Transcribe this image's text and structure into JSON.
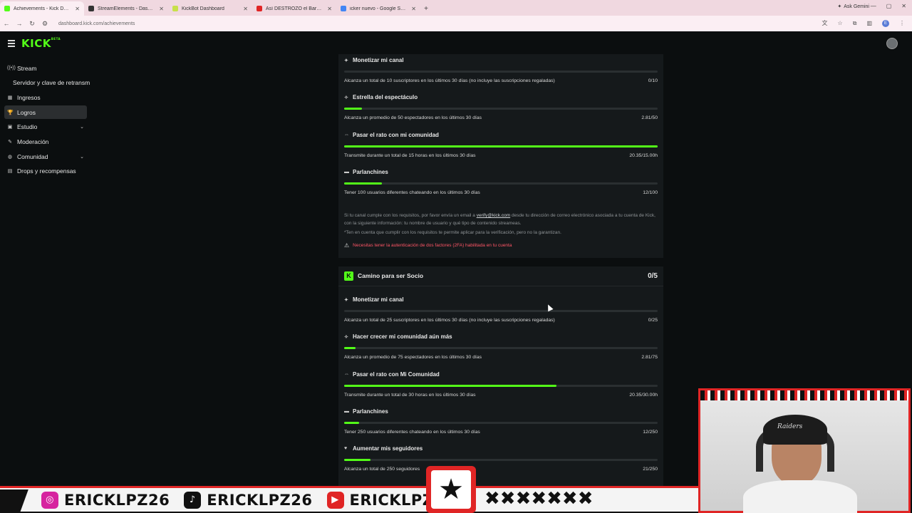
{
  "browser": {
    "tabs": [
      {
        "label": "Achievements - Kick Dashboard",
        "color": "#53fc18",
        "active": true
      },
      {
        "label": "StreamElements - Dashboard",
        "color": "#333333",
        "active": false
      },
      {
        "label": "KickBot Dashboard",
        "color": "#c8e04a",
        "active": false
      },
      {
        "label": "Así DESTROZÓ el Barça de Flick...",
        "color": "#e02525",
        "active": false
      },
      {
        "label": "icker nuevo - Google Search",
        "color": "#4285f4",
        "active": false
      }
    ],
    "new_tab": "+",
    "gemini": "Ask Gemini",
    "url": "dashboard.kick.com/achievements",
    "profile_letter": "E"
  },
  "app": {
    "logo": "KICK",
    "logo_sup": "BETA"
  },
  "sidebar": {
    "items": [
      {
        "label": "Stream",
        "icon": "stream-icon",
        "glyph": "((•))",
        "sub": false,
        "active": false,
        "chevron": false
      },
      {
        "label": "Servidor y clave de retransm",
        "icon": "",
        "glyph": "",
        "sub": true,
        "active": false,
        "chevron": false
      },
      {
        "label": "Ingresos",
        "icon": "revenue-icon",
        "glyph": "▦",
        "sub": false,
        "active": false,
        "chevron": false
      },
      {
        "label": "Logros",
        "icon": "trophy-icon",
        "glyph": "🏆",
        "sub": false,
        "active": true,
        "chevron": false
      },
      {
        "label": "Estudio",
        "icon": "studio-icon",
        "glyph": "▣",
        "sub": false,
        "active": false,
        "chevron": true
      },
      {
        "label": "Moderación",
        "icon": "wrench-icon",
        "glyph": "✎",
        "sub": false,
        "active": false,
        "chevron": false
      },
      {
        "label": "Comunidad",
        "icon": "community-icon",
        "glyph": "◍",
        "sub": false,
        "active": false,
        "chevron": true
      },
      {
        "label": "Drops y recompensas",
        "icon": "gift-icon",
        "glyph": "▤",
        "sub": false,
        "active": false,
        "chevron": false
      }
    ]
  },
  "card1": {
    "items": [
      {
        "title": "Monetizar mi canal",
        "icon": "spark-icon",
        "glyph": "✦",
        "desc": "Alcanza un total de 10 suscriptores en los últimos 30 días (no incluye las suscripciones regaladas)",
        "value": "0/10",
        "progress": 0.0
      },
      {
        "title": "Estrella del espectáculo",
        "icon": "star-people-icon",
        "glyph": "✧",
        "desc": "Alcanza un promedio de 50 espectadores en los últimos 30 días",
        "value": "2.81/50",
        "progress": 0.056
      },
      {
        "title": "Pasar el rato con mi comunidad",
        "icon": "link-icon",
        "glyph": "⇔",
        "desc": "Transmite durante un total de 15 horas en los últimos 30 días",
        "value": "20.35/15.00h",
        "progress": 1.0
      },
      {
        "title": "Parlanchines",
        "icon": "chat-icon",
        "glyph": "▬",
        "desc": "Tener 100 usuarios diferentes chateando en los últimos 30 días",
        "value": "12/100",
        "progress": 0.12
      }
    ],
    "note_pre": "Si tu canal cumple con los requisitos, por favor envía un email a ",
    "note_link": "verify@kick.com",
    "note_post": " desde tu dirección de correo electrónico asociada a tu cuenta de Kick, con la siguiente información: tu nombre de usuario y qué tipo de contenido streameas.",
    "note2": "*Ten en cuenta que cumplir con los requisitos te permite aplicar para la verificación, pero no la garantizan.",
    "warning": "Necesitas tener la autenticación de dos factores (2FA) habilitada en tu cuenta"
  },
  "card2": {
    "badge": "K",
    "title": "Camino para ser Socio",
    "count": "0/5",
    "items": [
      {
        "title": "Monetizar mi canal",
        "icon": "spark-icon",
        "glyph": "✦",
        "desc": "Alcanza un total de 25 suscriptores en los últimos 30 días (no incluye las suscripciones regaladas)",
        "value": "0/25",
        "progress": 0.0
      },
      {
        "title": "Hacer crecer mi comunidad aún más",
        "icon": "star-people-icon",
        "glyph": "✧",
        "desc": "Alcanza un promedio de 75 espectadores en los últimos 30 días",
        "value": "2.81/75",
        "progress": 0.037
      },
      {
        "title": "Pasar el rato con Mi Comunidad",
        "icon": "link-icon",
        "glyph": "⇔",
        "desc": "Transmite durante un total de 30 horas en los últimos 30 días",
        "value": "20.35/30.00h",
        "progress": 0.678
      },
      {
        "title": "Parlanchines",
        "icon": "chat-icon",
        "glyph": "▬",
        "desc": "Tener 250 usuarios diferentes chateando en los últimos 30 días",
        "value": "12/250",
        "progress": 0.048
      },
      {
        "title": "Aumentar mis seguidores",
        "icon": "heart-icon",
        "glyph": "♥",
        "desc": "Alcanza un total de 250 seguidores",
        "value": "21/250",
        "progress": 0.084
      }
    ]
  },
  "overlay": {
    "cap_text": "Raiders",
    "socials": [
      {
        "network": "instagram-icon",
        "glyph": "◎",
        "color": "#d6249f",
        "handle": "ERICKLPZ26"
      },
      {
        "network": "tiktok-icon",
        "glyph": "♪",
        "color": "#111111",
        "handle": "ERICKLPZ26"
      },
      {
        "network": "youtube-icon",
        "glyph": "▶",
        "color": "#e02525",
        "handle": "ERICKLPZ26"
      }
    ],
    "star": "★",
    "xs": "✖✖✖✖✖✖✖"
  },
  "colors": {
    "accent": "#53fc18",
    "warning": "#ff5566",
    "overlay_red": "#e02525"
  }
}
